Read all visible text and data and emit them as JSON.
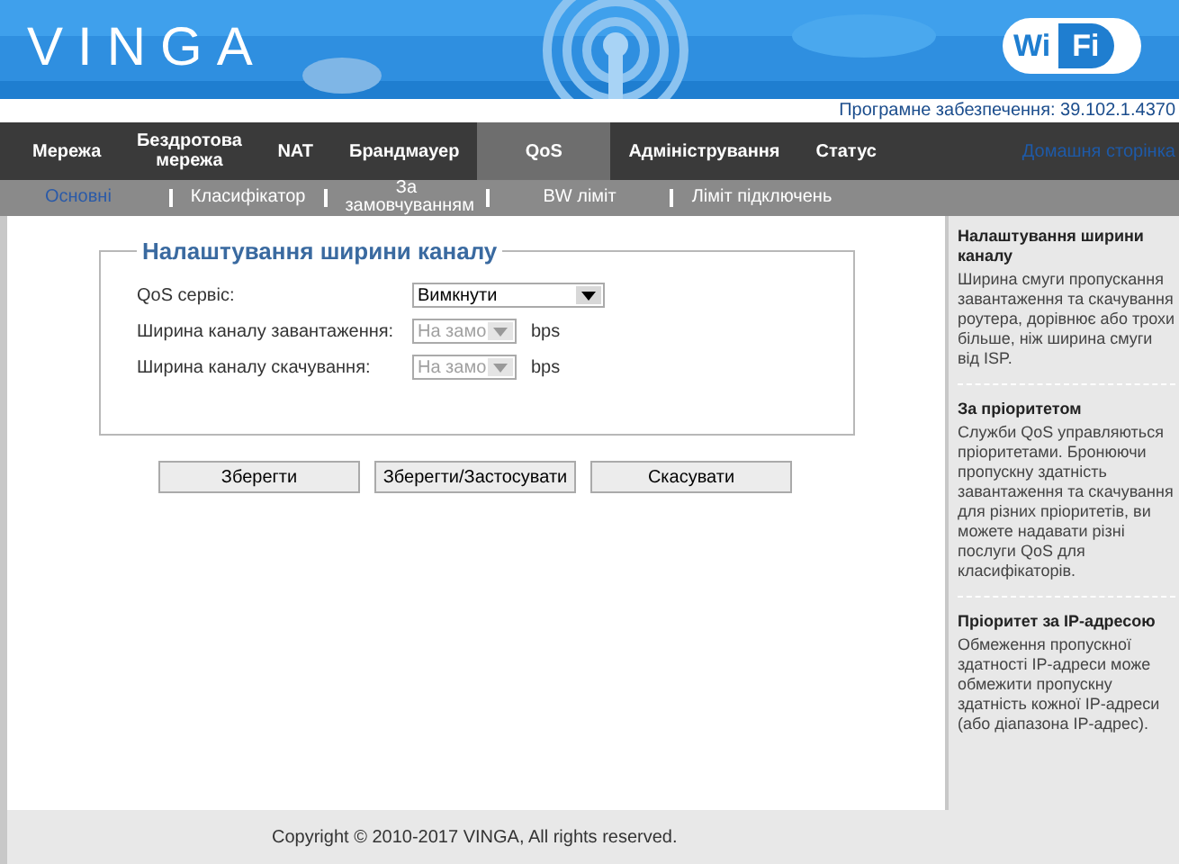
{
  "header": {
    "logo": "VINGA",
    "wifi_badge": [
      "Wi",
      "Fi"
    ]
  },
  "firmware": "Програмне забезпечення: 39.102.1.4370",
  "nav": [
    {
      "label": "Мережа",
      "selected": false
    },
    {
      "label": "Бездротова мережа",
      "selected": false
    },
    {
      "label": "NAT",
      "selected": false
    },
    {
      "label": "Брандмауер",
      "selected": false
    },
    {
      "label": "QoS",
      "selected": true
    },
    {
      "label": "Адміністрування",
      "selected": false
    },
    {
      "label": "Статус",
      "selected": false
    }
  ],
  "home_link": "Домашня сторінка",
  "subnav": [
    {
      "label": "Основні",
      "selected": true
    },
    {
      "label": "Класифікатор",
      "selected": false
    },
    {
      "label": "За замовчуванням",
      "selected": false
    },
    {
      "label": "BW ліміт",
      "selected": false
    },
    {
      "label": "Ліміт підключень",
      "selected": false
    }
  ],
  "form": {
    "title": "Налаштування ширини каналу",
    "rows": [
      {
        "label": "QoS сервіс:",
        "value": "Вимкнути",
        "disabled": false
      },
      {
        "label": "Ширина каналу завантаження:",
        "value": "На замо",
        "disabled": true,
        "unit": "bps"
      },
      {
        "label": "Ширина каналу скачування:",
        "value": "На замо",
        "disabled": true,
        "unit": "bps"
      }
    ]
  },
  "buttons": [
    "Зберегти",
    "Зберегти/Застосувати",
    "Скасувати"
  ],
  "help": [
    {
      "title": "Налаштування ширини каналу",
      "text": "Ширина смуги пропускання завантаження та скачування роутера, дорівнює або трохи більше, ніж ширина смуги від ISP."
    },
    {
      "title": "За пріоритетом",
      "text": "Служби QoS управляються пріоритетами. Бронюючи пропускну здатність завантаження та скачування для різних пріоритетів, ви можете надавати різні послуги QoS для класифікаторів."
    },
    {
      "title": "Пріоритет за IP-адресою",
      "text": "Обмеження пропускної здатності IP-адреси може обмежити пропускну здатність кожної IP-адреси (або діапазона IP-адрес)."
    }
  ],
  "footer": "Copyright © 2010-2017 VINGA, All rights reserved."
}
